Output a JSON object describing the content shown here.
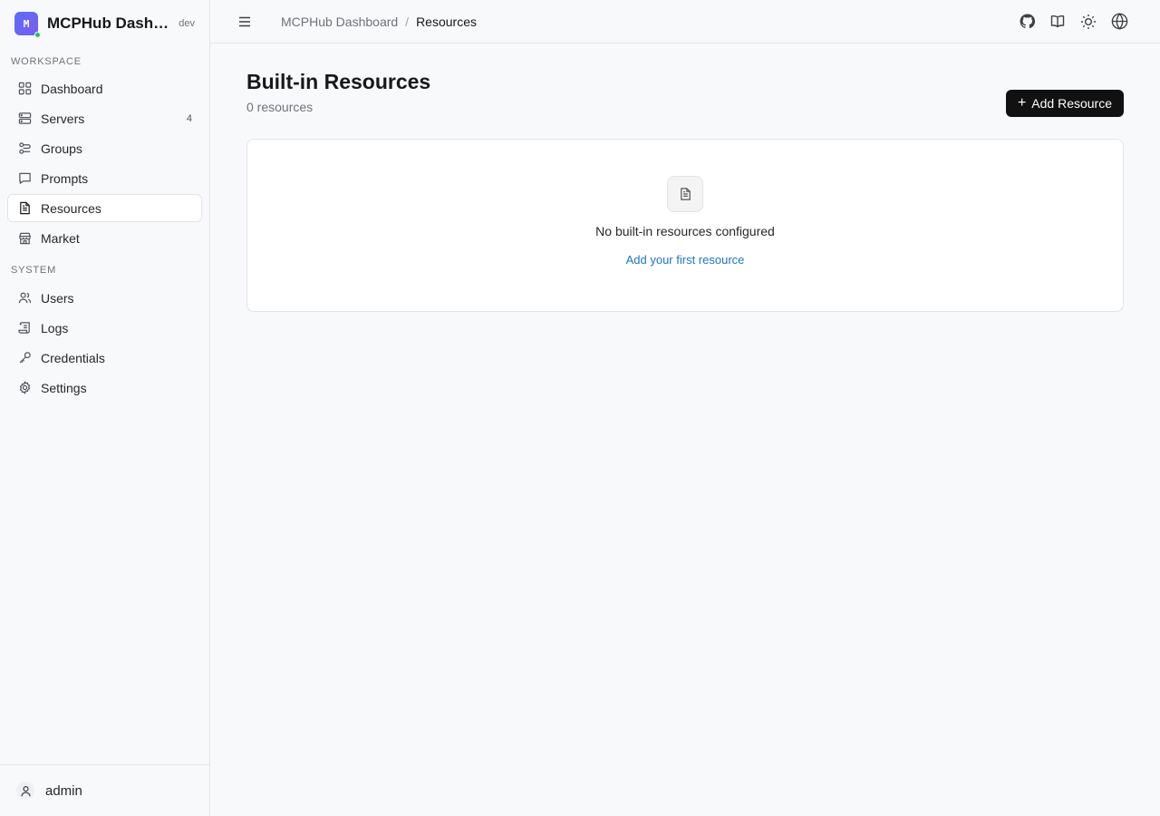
{
  "brand": {
    "logo_letter": "M",
    "name": "MCPHub Dashboard",
    "env": "dev"
  },
  "sidebar": {
    "workspace_label": "WORKSPACE",
    "system_label": "SYSTEM",
    "workspace_items": [
      {
        "label": "Dashboard",
        "icon": "grid-icon"
      },
      {
        "label": "Servers",
        "icon": "server-icon",
        "count": "4"
      },
      {
        "label": "Groups",
        "icon": "groups-icon"
      },
      {
        "label": "Prompts",
        "icon": "message-icon"
      },
      {
        "label": "Resources",
        "icon": "file-text-icon",
        "active": true
      },
      {
        "label": "Market",
        "icon": "store-icon"
      }
    ],
    "system_items": [
      {
        "label": "Users",
        "icon": "users-icon"
      },
      {
        "label": "Logs",
        "icon": "scroll-icon"
      },
      {
        "label": "Credentials",
        "icon": "key-icon"
      },
      {
        "label": "Settings",
        "icon": "gear-icon"
      }
    ],
    "user": "admin"
  },
  "topbar": {
    "breadcrumb_root": "MCPHub Dashboard",
    "breadcrumb_sep": "/",
    "breadcrumb_current": "Resources",
    "icons": [
      "github-icon",
      "book-icon",
      "sun-icon",
      "globe-icon"
    ]
  },
  "page": {
    "title": "Built-in Resources",
    "subtitle": "0 resources",
    "add_button": "Add Resource",
    "add_button_plus": "+"
  },
  "empty_state": {
    "icon": "file-text-icon",
    "message": "No built-in resources configured",
    "link": "Add your first resource"
  },
  "colors": {
    "accent_link": "#1d74c5",
    "primary_button": "#111111",
    "status_dot": "#22c55e"
  }
}
